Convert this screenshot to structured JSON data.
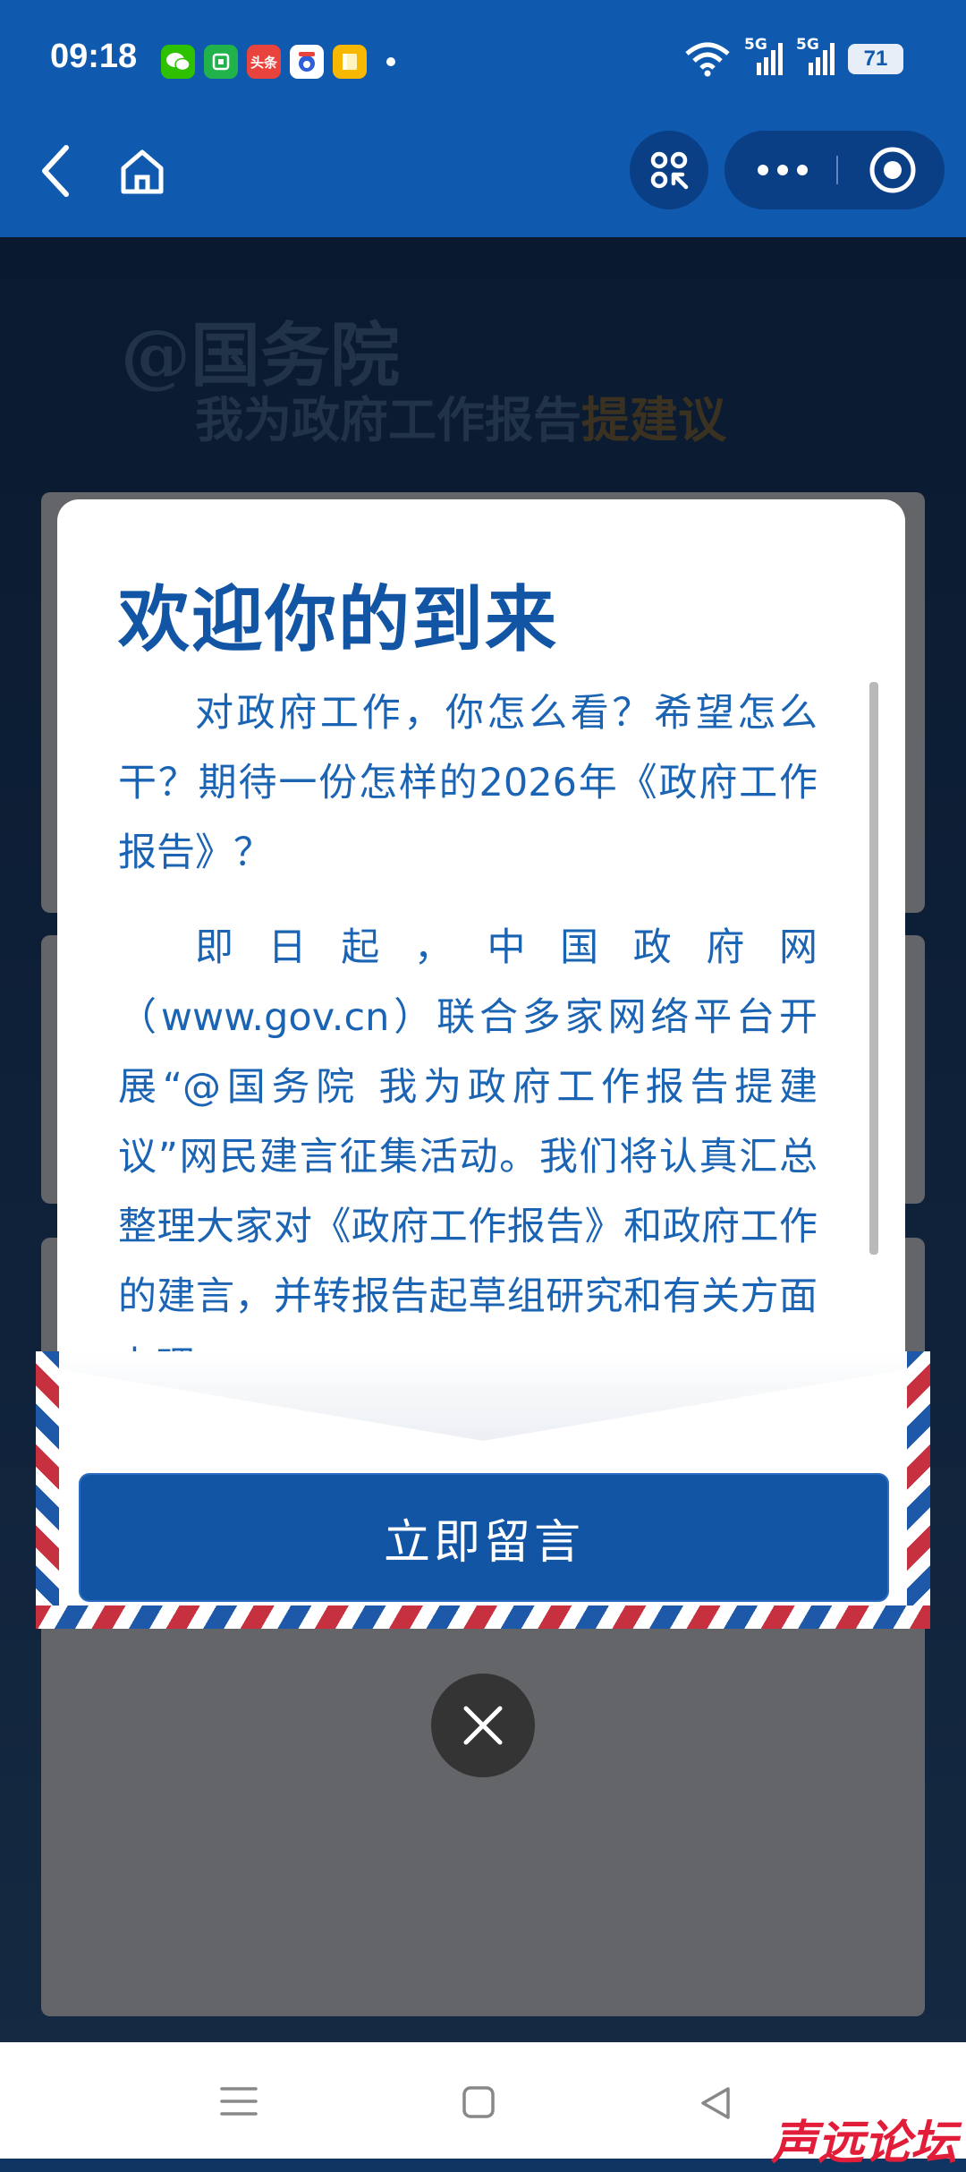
{
  "status_bar": {
    "time": "09:18",
    "notification_apps": [
      "wechat-icon",
      "wallet-icon",
      "toutiao-icon",
      "baidu-icon",
      "notes-icon"
    ],
    "toutiao_text": "头条",
    "signal_labels": [
      "5G",
      "5G"
    ],
    "battery": "71"
  },
  "nav": {
    "back": "back-icon",
    "home": "home-icon",
    "scan": "mini-program-icon",
    "more": "more-icon",
    "close": "target-icon"
  },
  "page": {
    "title": "@国务院",
    "subtitle": "我为政府工作报告",
    "subtitle_emphasis": "提建议"
  },
  "modal": {
    "title": "欢迎你的到来",
    "paragraph1": "对政府工作，你怎么看？希望怎么干？期待一份怎样的2026年《政府工作报告》？",
    "paragraph2": "即日起，中国政府网（www.gov.cn）联合多家网络平台开展“@国务院 我为政府工作报告提建议”网民建言征集活动。我们将认真汇总整理大家对《政府工作报告》和政府工作的建言，并转报告起草组研究和有关方面办理。",
    "cta": "立即留言"
  },
  "watermark": "声远论坛",
  "colors": {
    "primary": "#1255a5",
    "header": "#0f5aae",
    "stripe_red": "#c7303f",
    "stripe_blue": "#1d59a8"
  }
}
